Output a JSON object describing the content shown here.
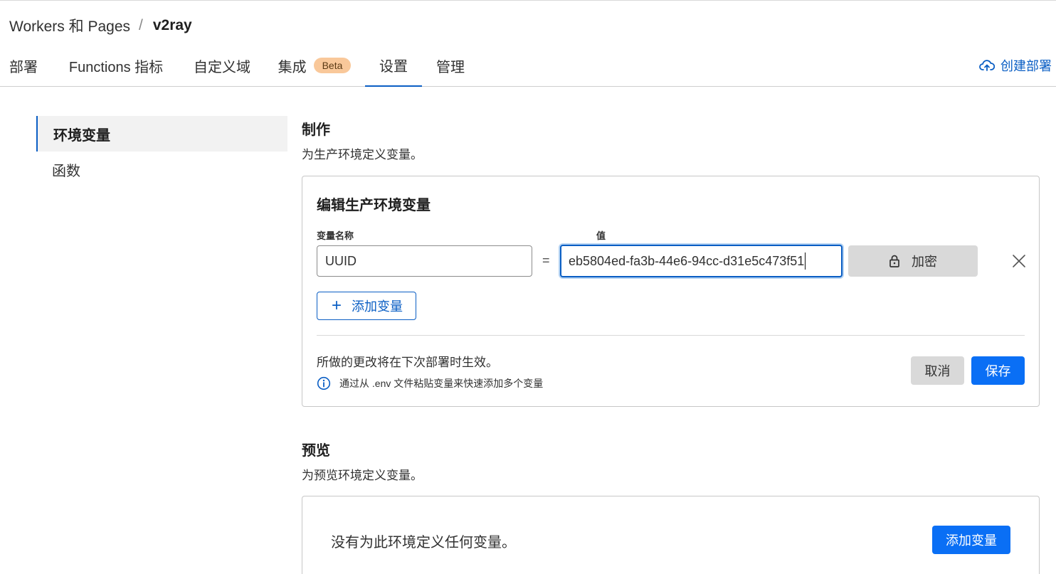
{
  "breadcrumb": {
    "parent": "Workers 和 Pages",
    "separator": "/",
    "current": "v2ray"
  },
  "tabs": [
    {
      "label": "部署"
    },
    {
      "label": "Functions 指标"
    },
    {
      "label": "自定义域"
    },
    {
      "label": "集成",
      "badge": "Beta"
    },
    {
      "label": "设置",
      "active": true
    },
    {
      "label": "管理"
    }
  ],
  "header_action": {
    "label": "创建部署",
    "icon": "cloud-upload-icon"
  },
  "sidebar": {
    "items": [
      {
        "label": "环境变量",
        "active": true
      },
      {
        "label": "函数"
      }
    ]
  },
  "production": {
    "title": "制作",
    "description": "为生产环境定义变量。",
    "card": {
      "title": "编辑生产环境变量",
      "name_label": "变量名称",
      "value_label": "值",
      "variable": {
        "name": "UUID",
        "equals": "=",
        "value": "eb5804ed-fa3b-44e6-94cc-d31e5c473f51"
      },
      "encrypt_label": "加密",
      "add_variable_label": "添加变量",
      "note": "所做的更改将在下次部署时生效。",
      "hint": "通过从 .env 文件粘贴变量来快速添加多个变量",
      "cancel_label": "取消",
      "save_label": "保存"
    }
  },
  "preview": {
    "title": "预览",
    "description": "为预览环境定义变量。",
    "empty_text": "没有为此环境定义任何变量。",
    "add_variable_label": "添加变量"
  },
  "colors": {
    "accent": "#0a5ec4",
    "primary_button": "#0a6ff5",
    "badge": "#f9c89a",
    "muted_button": "#d9d9d9"
  }
}
